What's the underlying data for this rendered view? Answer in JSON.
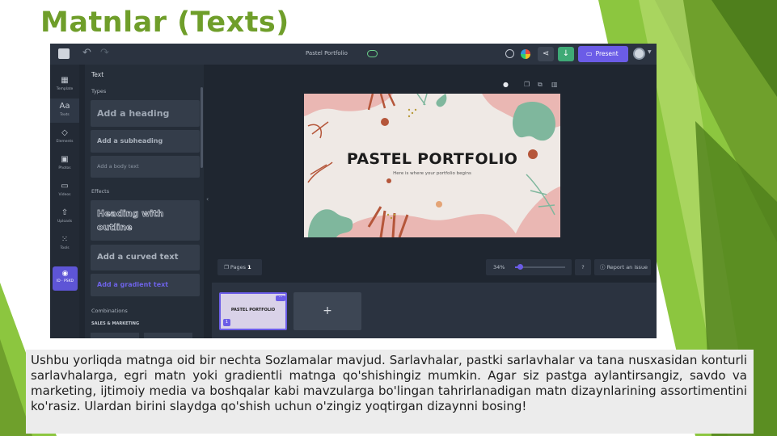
{
  "title": "Matnlar (Texts)",
  "editor": {
    "doc_title": "Pastel Portfolio",
    "present_label": "Present",
    "sidebar_items": [
      {
        "label": "Template",
        "icon": "templates-icon"
      },
      {
        "label": "Texts",
        "icon": "text-icon"
      },
      {
        "label": "Elements",
        "icon": "elements-icon"
      },
      {
        "label": "Photos",
        "icon": "photos-icon"
      },
      {
        "label": "Videos",
        "icon": "videos-icon"
      },
      {
        "label": "Uploads",
        "icon": "uploads-icon"
      },
      {
        "label": "Tools",
        "icon": "tools-icon"
      }
    ],
    "brand_label": "ID · PSKD",
    "panel": {
      "title": "Text",
      "types_label": "Types",
      "heading": "Add a heading",
      "subheading": "Add a subheading",
      "body": "Add a body text",
      "effects_label": "Effects",
      "outline": "Heading with outline",
      "curved": "Add a curved text",
      "gradient": "Add a gradient text",
      "combinations_label": "Combinations",
      "sales_label": "SALES & MARKETING"
    },
    "slide": {
      "title": "PASTEL PORTFOLIO",
      "subtitle": "Here is where your portfolio begins"
    },
    "pages_label": "Pages",
    "pages_count": "1",
    "zoom": "34%",
    "zoom_value": 0.34,
    "help_label": "?",
    "report_label": "Report an issue",
    "thumb_title": "PASTEL PORTFOLIO",
    "thumb_number": "1",
    "thumb_menu": "···",
    "add_page_label": "+"
  },
  "description": "Ushbu yorliqda matnga oid bir nechta Sozlamalar mavjud. Sarlavhalar, pastki sarlavhalar va tana nusxasidan konturli sarlavhalarga, egri matn yoki gradientli matnga qo'shishingiz mumkin. Agar siz pastga aylantirsangiz, savdo va marketing, ijtimoiy media va boshqalar kabi mavzularga bo'lingan tahrirlanadigan matn dizaynlarining assortimentini ko'rasiz. Ulardan birini slaydga qo'shish uchun o'zingiz yoqtirgan dizaynni bosing!",
  "colors": {
    "title_green": "#6f9e2a",
    "accent_purple": "#6b5ce7",
    "editor_bg": "#1f2630"
  }
}
